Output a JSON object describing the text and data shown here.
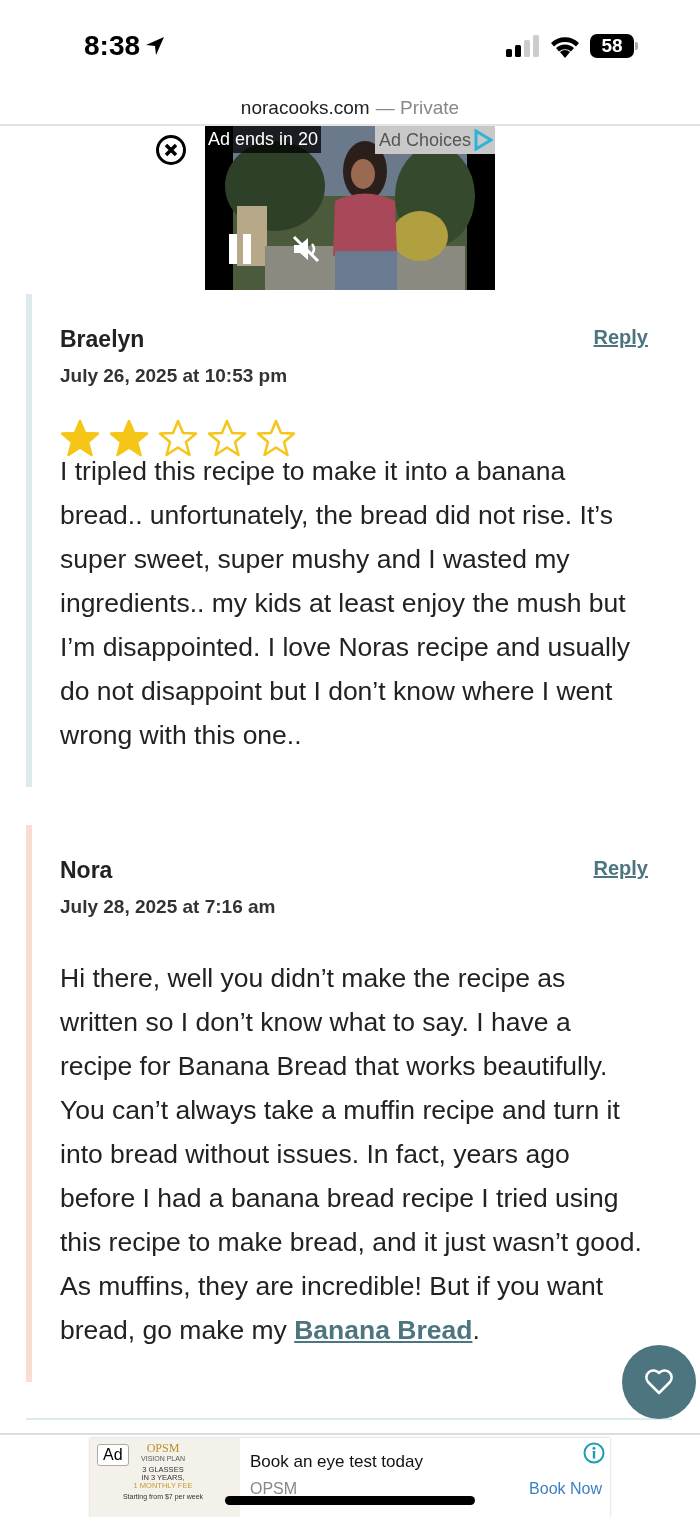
{
  "status_bar": {
    "time": "8:38",
    "battery": "58"
  },
  "address_bar": {
    "domain": "noracooks.com",
    "mode": "— Private"
  },
  "video_ad": {
    "kind": "picture",
    "countdown": "Ad ends in 20",
    "choices": "Ad Choices"
  },
  "comments": [
    {
      "author": "Braelyn",
      "date": "July 26, 2025 at 10:53 pm",
      "reply": "Reply",
      "stars": 2,
      "color": "#dcebec",
      "body": "I tripled this recipe to make it into a banana bread.. unfortunately, the bread did not rise. It’s super sweet, super mushy and I wasted my ingredients.. my kids at least enjoy the mush but I’m disappointed. I love Noras recipe and usually do not disappoint but I don’t know where I went wrong with this one.."
    },
    {
      "author": "Nora",
      "date": "July 28, 2025 at 7:16 am",
      "reply": "Reply",
      "color": "#f9ddd3",
      "body": "Hi there, well you didn’t make the recipe as written so I don’t know what to say. I have a recipe for Banana Bread that works beautifully. You can’t always take a muffin recipe and turn it into bread without issues. In fact, years ago before I had a banana bread recipe I tried using this recipe to make bread, and it just wasn’t good. As muffins, they are incredible! But if you want bread, go make my ",
      "link": "Banana Bread",
      "after": "."
    }
  ],
  "banner_ad": {
    "badge": "Ad",
    "brand": "OPSM",
    "brand_sub": "VISION PLAN",
    "offer": [
      "3 GLASSES",
      "IN 3 YEARS,"
    ],
    "offer_fee": "1 MONTHLY FEE",
    "offer_note": "Starting from $7 per week",
    "headline": "Book an eye test today",
    "advertiser": "OPSM",
    "cta": "Book Now"
  }
}
